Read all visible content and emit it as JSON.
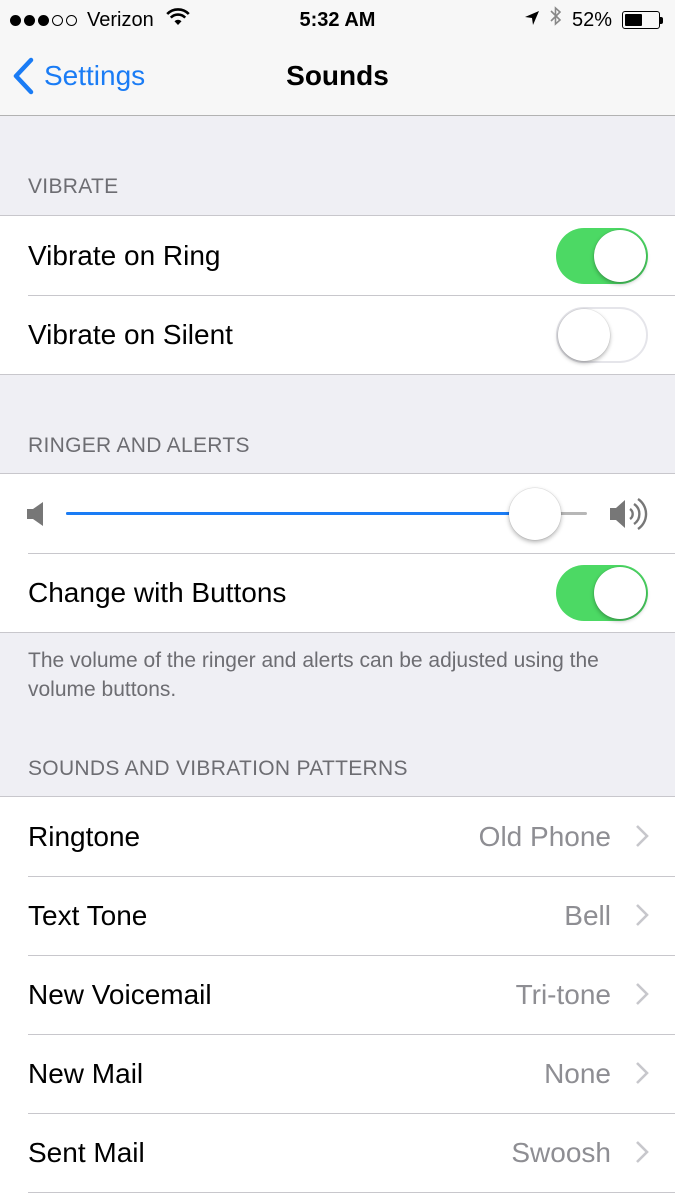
{
  "status_bar": {
    "signal_full": 3,
    "signal_total": 5,
    "carrier": "Verizon",
    "time": "5:32 AM",
    "battery_text": "52%",
    "battery_level": 0.52
  },
  "nav": {
    "back_label": "Settings",
    "title": "Sounds"
  },
  "vibrate": {
    "header": "VIBRATE",
    "rows": [
      {
        "label": "Vibrate on Ring",
        "on": true
      },
      {
        "label": "Vibrate on Silent",
        "on": false
      }
    ]
  },
  "ringer": {
    "header": "RINGER AND ALERTS",
    "volume_level": 0.9,
    "change_with_buttons": {
      "label": "Change with Buttons",
      "on": true
    },
    "footnote": "The volume of the ringer and alerts can be adjusted using the volume buttons."
  },
  "sounds": {
    "header": "SOUNDS AND VIBRATION PATTERNS",
    "rows": [
      {
        "label": "Ringtone",
        "value": "Old Phone"
      },
      {
        "label": "Text Tone",
        "value": "Bell"
      },
      {
        "label": "New Voicemail",
        "value": "Tri-tone"
      },
      {
        "label": "New Mail",
        "value": "None"
      },
      {
        "label": "Sent Mail",
        "value": "Swoosh"
      }
    ]
  },
  "colors": {
    "accent": "#1a7cf5",
    "toggle_on": "#4cd964",
    "background": "#efeff4"
  }
}
